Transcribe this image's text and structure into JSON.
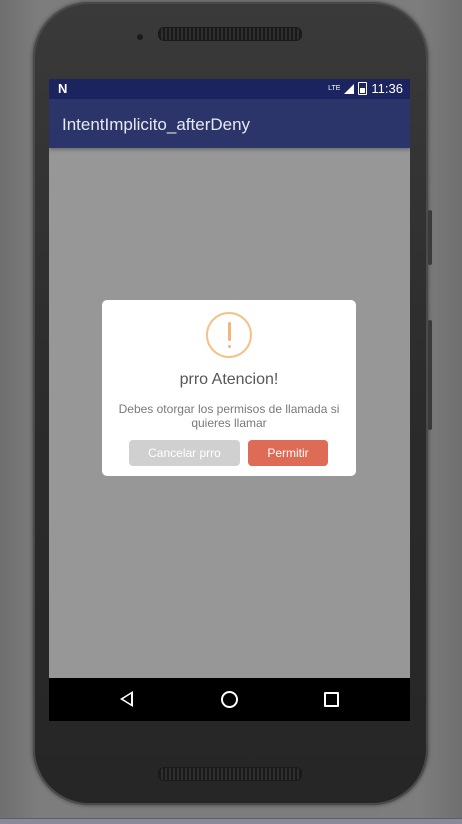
{
  "statusbar": {
    "carrier_logo": "N",
    "network": "LTE",
    "time": "11:36"
  },
  "appbar": {
    "title": "IntentImplicito_afterDeny"
  },
  "dialog": {
    "icon": "warning-icon",
    "title": "prro Atencion!",
    "message": "Debes otorgar los permisos de llamada si quieres llamar",
    "cancel_label": "Cancelar prro",
    "confirm_label": "Permitir"
  },
  "navbar": {
    "back": "back-icon",
    "home": "home-icon",
    "recents": "recents-icon"
  },
  "colors": {
    "statusbar": "#1c2460",
    "appbar": "#2b3569",
    "confirm_button": "#dd6b55",
    "cancel_button": "#d0d0d0",
    "warning_icon": "#f5c08a",
    "screen_dim": "#979797"
  }
}
